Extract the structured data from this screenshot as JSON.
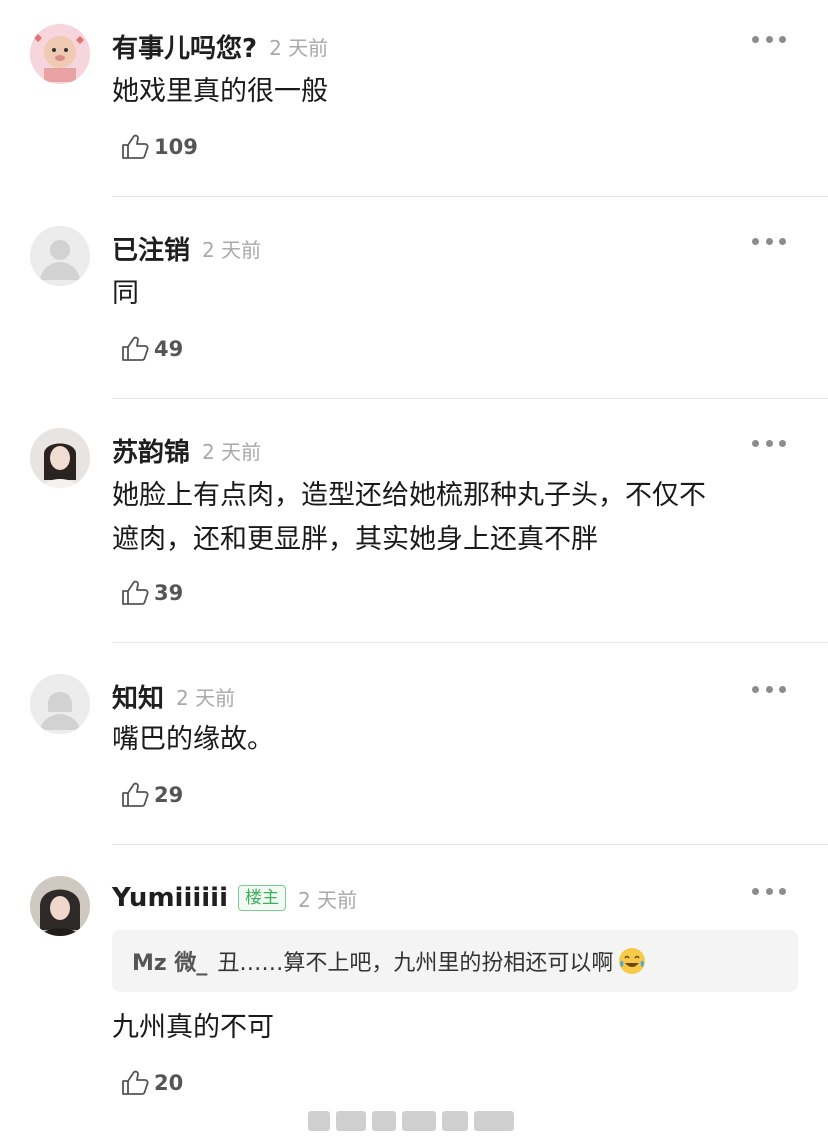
{
  "icons": {
    "like": "thumbs-up-icon",
    "more": "more-dots-icon"
  },
  "colors": {
    "badge_green": "#3fae5a",
    "time_gray": "#a9a9a9",
    "divider": "#e6e6e6"
  },
  "comments": [
    {
      "name": "有事儿吗您?",
      "time": "2 天前",
      "text": "她戏里真的很一般",
      "likes": "109"
    },
    {
      "name": "已注销",
      "time": "2 天前",
      "text": "同",
      "likes": "49"
    },
    {
      "name": "苏韵锦",
      "time": "2 天前",
      "text_line1": "她脸上有点肉，造型还给她梳那种丸子头，不仅不",
      "text_line2": "遮肉，还和更显胖，其实她身上还真不胖",
      "likes": "39"
    },
    {
      "name": "知知",
      "time": "2 天前",
      "text": "嘴巴的缘故。",
      "likes": "29"
    },
    {
      "name": "Yumiiiiii",
      "badge": "楼主",
      "time": "2 天前",
      "quote_name": "Mz 微_",
      "quote_text": "丑……算不上吧，九州里的扮相还可以啊",
      "text": "九州真的不可",
      "likes": "20"
    }
  ]
}
